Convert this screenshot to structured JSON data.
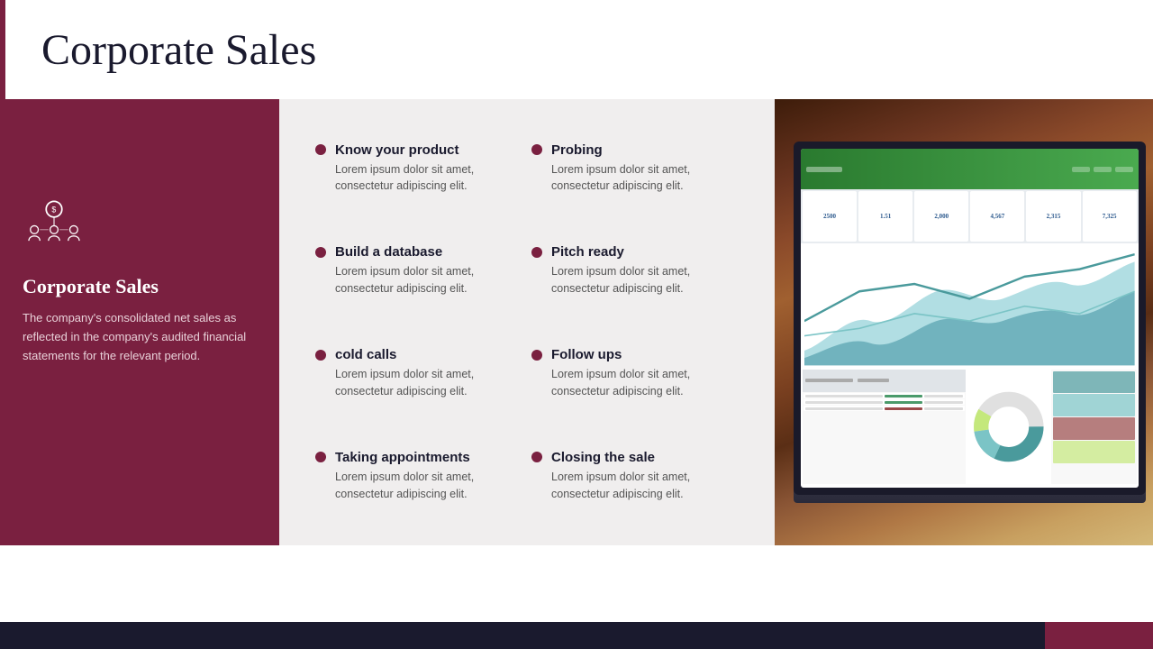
{
  "header": {
    "title": "Corporate Sales",
    "accent_color": "#7a2040"
  },
  "left_panel": {
    "title": "Corporate Sales",
    "description": "The company's consolidated net sales as reflected in the company's audited financial statements for the relevant period.",
    "bg_color": "#7a2040"
  },
  "list_items": [
    {
      "title": "Know your product",
      "body": "Lorem ipsum dolor sit amet, consectetur adipiscing elit."
    },
    {
      "title": "Probing",
      "body": "Lorem ipsum dolor sit amet, consectetur adipiscing elit."
    },
    {
      "title": "Build a database",
      "body": "Lorem ipsum dolor sit amet, consectetur adipiscing elit."
    },
    {
      "title": "Pitch ready",
      "body": "Lorem ipsum dolor sit amet, consectetur adipiscing elit."
    },
    {
      "title": "cold calls",
      "body": "Lorem ipsum dolor sit amet, consectetur adipiscing elit."
    },
    {
      "title": "Follow ups",
      "body": "Lorem ipsum dolor sit amet, consectetur adipiscing elit."
    },
    {
      "title": "Taking appointments",
      "body": "Lorem ipsum dolor sit amet, consectetur adipiscing elit."
    },
    {
      "title": "Closing the sale",
      "body": "Lorem ipsum dolor sit amet, consectetur adipiscing elit."
    }
  ],
  "dashboard": {
    "stats": [
      "2500",
      "1.51",
      "2,000",
      "4,567",
      "2,315",
      "7,325"
    ]
  }
}
